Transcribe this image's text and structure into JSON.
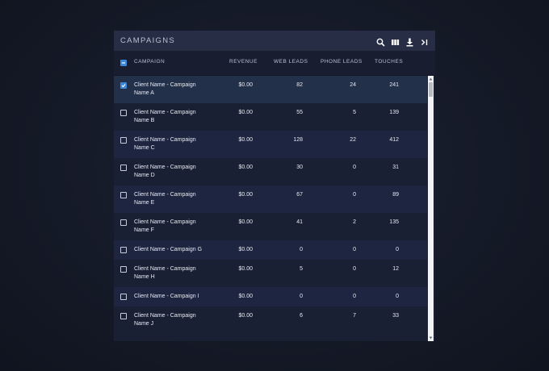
{
  "title": "CAMPAIGNS",
  "toolbar": [
    "search-icon",
    "columns-icon",
    "download-icon",
    "collapse-icon"
  ],
  "columns": {
    "campaign": "CAMPAIGN",
    "revenue": "REVENUE",
    "web": "WEB LEADS",
    "phone": "PHONE LEADS",
    "touches": "TOUCHES"
  },
  "rows": [
    {
      "line1": "Client Name - Campaign",
      "line2": "Name A",
      "revenue": "$0.00",
      "web": "82",
      "phone": "24",
      "touches": "241",
      "checked": true
    },
    {
      "line1": "Client Name - Campaign",
      "line2": "Name B",
      "revenue": "$0.00",
      "web": "55",
      "phone": "5",
      "touches": "139",
      "checked": false
    },
    {
      "line1": "Client Name - Campaign",
      "line2": "Name C",
      "revenue": "$0.00",
      "web": "128",
      "phone": "22",
      "touches": "412",
      "checked": false
    },
    {
      "line1": "Client Name - Campaign",
      "line2": "Name D",
      "revenue": "$0.00",
      "web": "30",
      "phone": "0",
      "touches": "31",
      "checked": false
    },
    {
      "line1": "Client Name - Campaign",
      "line2": "Name E",
      "revenue": "$0.00",
      "web": "67",
      "phone": "0",
      "touches": "89",
      "checked": false
    },
    {
      "line1": "Client Name - Campaign",
      "line2": "Name F",
      "revenue": "$0.00",
      "web": "41",
      "phone": "2",
      "touches": "135",
      "checked": false
    },
    {
      "line1": "Client Name - Campaign G",
      "line2": "",
      "revenue": "$0.00",
      "web": "0",
      "phone": "0",
      "touches": "0",
      "checked": false
    },
    {
      "line1": "Client Name - Campaign",
      "line2": "Name H",
      "revenue": "$0.00",
      "web": "5",
      "phone": "0",
      "touches": "12",
      "checked": false
    },
    {
      "line1": "Client Name - Campaign I",
      "line2": "",
      "revenue": "$0.00",
      "web": "0",
      "phone": "0",
      "touches": "0",
      "checked": false
    },
    {
      "line1": "Client Name - Campaign",
      "line2": "Name J",
      "revenue": "$0.00",
      "web": "6",
      "phone": "7",
      "touches": "33",
      "checked": false
    }
  ]
}
